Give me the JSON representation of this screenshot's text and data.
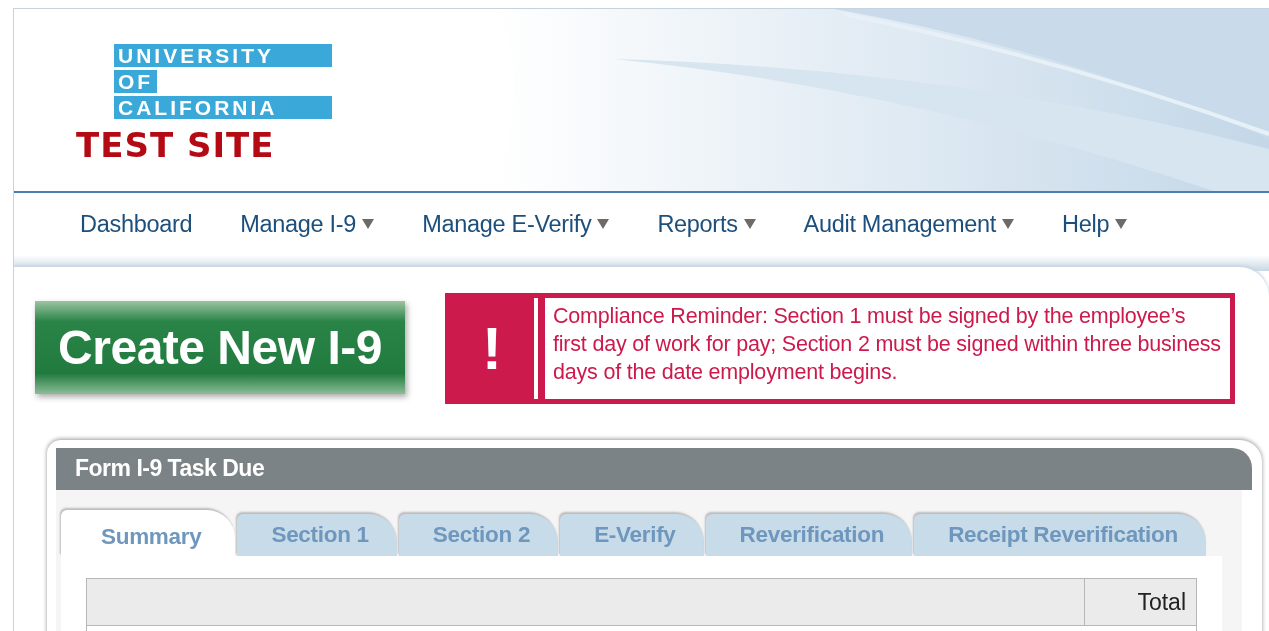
{
  "logo": {
    "lines": [
      "UNIVERSITY",
      "OF",
      "CALIFORNIA"
    ],
    "site": "TEST SITE"
  },
  "nav": [
    {
      "label": "Dashboard",
      "dropdown": false
    },
    {
      "label": "Manage I-9",
      "dropdown": true
    },
    {
      "label": "Manage E-Verify",
      "dropdown": true
    },
    {
      "label": "Reports",
      "dropdown": true
    },
    {
      "label": "Audit Management",
      "dropdown": true
    },
    {
      "label": "Help",
      "dropdown": true
    }
  ],
  "create_button": "Create New I-9",
  "alert": {
    "icon": "!",
    "message": "Compliance Reminder: Section 1 must be signed by the employee’s first day of work for pay; Section 2 must be signed within three business days of the date employment begins."
  },
  "panel": {
    "title": "Form I-9 Task Due",
    "tabs": [
      {
        "label": "Summary",
        "selected": true
      },
      {
        "label": "Section 1",
        "selected": false
      },
      {
        "label": "Section 2",
        "selected": false
      },
      {
        "label": "E-Verify",
        "selected": false
      },
      {
        "label": "Reverification",
        "selected": false
      },
      {
        "label": "Receipt Reverification",
        "selected": false
      }
    ],
    "table": {
      "column_2": "Total"
    }
  }
}
